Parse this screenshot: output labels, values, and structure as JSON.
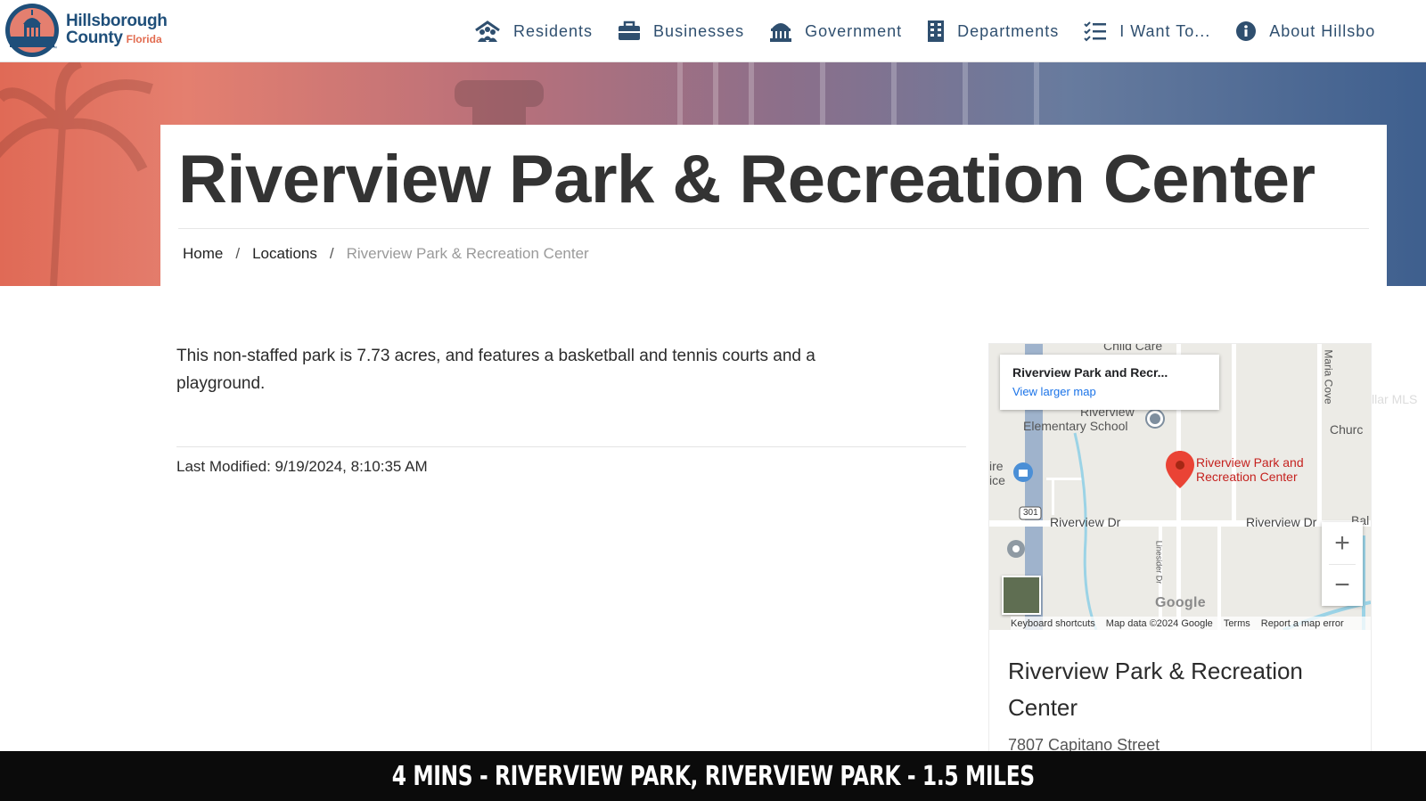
{
  "logo": {
    "line1": "Hillsborough",
    "line2": "County",
    "state": "Florida",
    "tm": "™"
  },
  "nav": {
    "items": [
      {
        "label": "Residents",
        "icon": "residents-icon"
      },
      {
        "label": "Businesses",
        "icon": "briefcase-icon"
      },
      {
        "label": "Government",
        "icon": "government-building-icon"
      },
      {
        "label": "Departments",
        "icon": "office-building-icon"
      },
      {
        "label": "I Want To...",
        "icon": "checklist-icon"
      },
      {
        "label": "About Hillsbo",
        "icon": "info-icon"
      }
    ]
  },
  "page": {
    "title": "Riverview Park & Recreation Center",
    "breadcrumb": {
      "home": "Home",
      "separator": "/",
      "locations": "Locations",
      "current": "Riverview Park & Recreation Center"
    },
    "description": "This non-staffed park is 7.73 acres, and features a basketball and tennis courts and a playground.",
    "last_modified": "Last Modified: 9/19/2024, 8:10:35 AM"
  },
  "map": {
    "info_title": "Riverview Park and Recr...",
    "info_link": "View larger map",
    "pin_label_line1": "Riverview Park and",
    "pin_label_line2": "Recreation Center",
    "labels": {
      "child_care": "Child Care",
      "school_line1": "Riverview",
      "school_line2": "Elementary School",
      "maria_cove": "Maria Cove",
      "church": "Churc",
      "fire_line1": "ire",
      "fire_line2": "ice",
      "route": "301",
      "riverview_dr_left": "Riverview Dr",
      "riverview_dr_right": "Riverview Dr",
      "bal": "Bal",
      "linesider": "Linesider Dr"
    },
    "zoom_in": "+",
    "zoom_out": "−",
    "google": "Google",
    "footer": {
      "shortcuts": "Keyboard shortcuts",
      "data": "Map data ©2024 Google",
      "terms": "Terms",
      "report": "Report a map error"
    },
    "watermark": "Stellar MLS"
  },
  "location_card": {
    "title": "Riverview Park & Recreation Center",
    "address": "7807 Capitano Street"
  },
  "caption": {
    "text": "4 MINS - RIVERVIEW PARK, RIVERVIEW PARK - 1.5 MILES"
  },
  "colors": {
    "brand_navy": "#1f4f7a",
    "brand_coral": "#e26b4f",
    "nav_text": "#2f4f6f",
    "pin_red": "#c5221f",
    "link_blue": "#1a73e8"
  }
}
